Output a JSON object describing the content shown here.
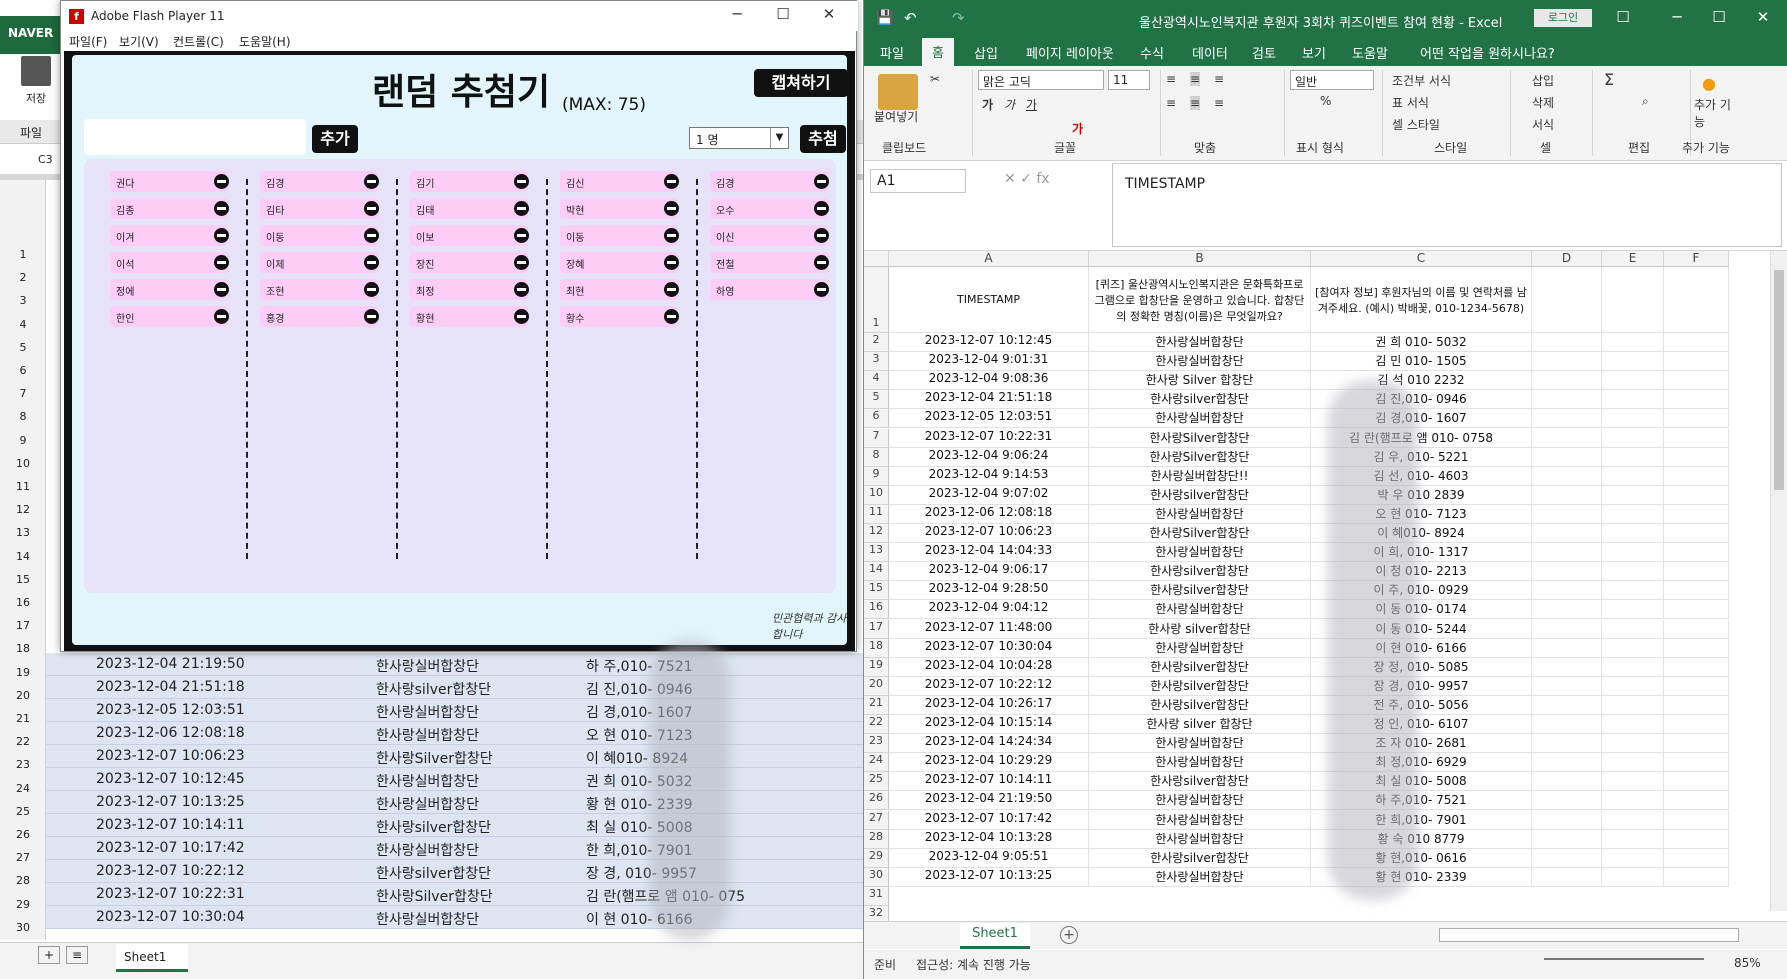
{
  "bg_excel": {
    "brand": "NAVER",
    "save_label": "저장",
    "file_label": "파일",
    "cell_ref": "C3",
    "sheet_tab": "Sheet1",
    "add_tab": "+",
    "menu_tab": "≡",
    "row_numbers": [
      "1",
      "2",
      "3",
      "4",
      "5",
      "6",
      "7",
      "8",
      "9",
      "10",
      "11",
      "12",
      "13",
      "14",
      "15",
      "16",
      "17",
      "18",
      "19",
      "20",
      "21",
      "22",
      "23",
      "24",
      "25",
      "26",
      "27",
      "28",
      "29",
      "30"
    ],
    "rows": [
      {
        "n": "19",
        "ts": "2023-12-04 21:19:50",
        "a": "한사랑실버합창단",
        "c": "하 주,010-    7521"
      },
      {
        "n": "20",
        "ts": "2023-12-04 21:51:18",
        "a": "한사랑silver합창단",
        "c": "김 진,010-   0946"
      },
      {
        "n": "21",
        "ts": "2023-12-05 12:03:51",
        "a": "한사랑실버합창단",
        "c": "김 경,010-   1607"
      },
      {
        "n": "22",
        "ts": "2023-12-06 12:08:18",
        "a": "한사랑실버합창단",
        "c": "오 현 010-   7123"
      },
      {
        "n": "23",
        "ts": "2023-12-07 10:06:23",
        "a": "한사랑Silver합창단",
        "c": "이 혜010-   8924"
      },
      {
        "n": "24",
        "ts": "2023-12-07 10:12:45",
        "a": "한사랑실버합창단",
        "c": "권 희 010-   5032"
      },
      {
        "n": "25",
        "ts": "2023-12-07 10:13:25",
        "a": "한사랑실버합창단",
        "c": "황 현 010-   2339"
      },
      {
        "n": "26",
        "ts": "2023-12-07 10:14:11",
        "a": "한사랑silver합창단",
        "c": "최 실 010-   5008"
      },
      {
        "n": "27",
        "ts": "2023-12-07 10:17:42",
        "a": "한사랑실버합창단",
        "c": "한 희,010-   7901"
      },
      {
        "n": "28",
        "ts": "2023-12-07 10:22:12",
        "a": "한사랑silver합창단",
        "c": "장 경, 010-  9957"
      },
      {
        "n": "29",
        "ts": "2023-12-07 10:22:31",
        "a": "한사랑Silver합창단",
        "c": "김 란(햄프로 앰  010-   075"
      },
      {
        "n": "30",
        "ts": "2023-12-07 10:30:04",
        "a": "한사랑실버합창단",
        "c": "이 현 010-   6166"
      }
    ]
  },
  "flash": {
    "window_title": "Adobe Flash Player 11",
    "logo": "f",
    "menu": [
      "파일(F)",
      "보기(V)",
      "컨트롤(C)",
      "도움말(H)"
    ],
    "controls": [
      "─",
      "☐",
      "✕"
    ],
    "app_title": "랜덤 추첨기",
    "max_label": "(MAX: 75)",
    "capture_button": "캡쳐하기",
    "add_button": "추가",
    "draw_button": "추첨",
    "count_select": "1 명",
    "signature": "민관협력과 감사합니다",
    "columns": [
      [
        "권다",
        "김종",
        "이겨",
        "이석",
        "정에",
        "한인"
      ],
      [
        "김경",
        "김타",
        "이동",
        "이제",
        "조현",
        "홍경"
      ],
      [
        "김기",
        "김태",
        "이보",
        "장진",
        "최정",
        "황현"
      ],
      [
        "김신",
        "박현",
        "이동",
        "장혜",
        "최현",
        "황수"
      ],
      [
        "김경",
        "오수",
        "이신",
        "전철",
        "하영"
      ]
    ]
  },
  "excel": {
    "window_title": "울산광역시노인복지관 후원자 3회차 퀴즈이벤트 참여 현황  -  Excel",
    "login": "로그인",
    "controls": [
      "☐",
      "─",
      "☐",
      "✕"
    ],
    "tabs": [
      "파일",
      "홈",
      "삽입",
      "페이지 레이아웃",
      "수식",
      "데이터",
      "검토",
      "보기",
      "도움말",
      "어떤 작업을 원하시나요?"
    ],
    "ribbon": {
      "paste": "붙여넣기",
      "clipboard": "클립보드",
      "font_name": "맑은 고딕",
      "font_size": "11",
      "font_group": "글꼴",
      "align_group": "맞춤",
      "number_format": "일반",
      "number_group": "표시 형식",
      "cond_format": "조건부 서식",
      "table_format": "표 서식",
      "cell_style": "셀 스타일",
      "style_group": "스타일",
      "insert": "삽입",
      "delete": "삭제",
      "format": "서식",
      "cell_group": "셀",
      "edit_group": "편집",
      "addin": "추가 기능",
      "addin_group": "추가 기능"
    },
    "name_box": "A1",
    "formula": "TIMESTAMP",
    "columns": [
      "A",
      "B",
      "C",
      "D",
      "E",
      "F"
    ],
    "header_row": {
      "a": "TIMESTAMP",
      "b": "[퀴즈] 울산광역시노인복지관은 문화특화프로그램으로 합창단을 운영하고 있습니다. 합창단의 정확한 명칭(이름)은 무엇일까요?",
      "c": "[참여자 정보] 후원자님의 이름 및 연락처를 남겨주세요. (예시) 박배꽃, 010-1234-5678)"
    },
    "rows": [
      {
        "n": "2",
        "a": "2023-12-07 10:12:45",
        "b": "한사랑실버합창단",
        "c": "권 희 010-   5032"
      },
      {
        "n": "3",
        "a": "2023-12-04 9:01:31",
        "b": "한사랑실버합창단",
        "c": "김 민 010-   1505"
      },
      {
        "n": "4",
        "a": "2023-12-04 9:08:36",
        "b": "한사랑 Silver 합창단",
        "c": "김 석 010   2232"
      },
      {
        "n": "5",
        "a": "2023-12-04 21:51:18",
        "b": "한사랑silver합창단",
        "c": "김 진,010-   0946"
      },
      {
        "n": "6",
        "a": "2023-12-05 12:03:51",
        "b": "한사랑실버합창단",
        "c": "김 경,010-   1607"
      },
      {
        "n": "7",
        "a": "2023-12-07 10:22:31",
        "b": "한사랑Silver합창단",
        "c": "김 란(햄프로 앰   010-   0758"
      },
      {
        "n": "8",
        "a": "2023-12-04 9:06:24",
        "b": "한사랑Silver합창단",
        "c": "김 우, 010-  5221"
      },
      {
        "n": "9",
        "a": "2023-12-04 9:14:53",
        "b": "한사랑실버합창단!!",
        "c": "김 선, 010-   4603"
      },
      {
        "n": "10",
        "a": "2023-12-04 9:07:02",
        "b": "한사랑silver합창단",
        "c": "박 우 010   2839"
      },
      {
        "n": "11",
        "a": "2023-12-06 12:08:18",
        "b": "한사랑실버합창단",
        "c": "오 현 010-   7123"
      },
      {
        "n": "12",
        "a": "2023-12-07 10:06:23",
        "b": "한사랑Silver합창단",
        "c": "이 혜010-   8924"
      },
      {
        "n": "13",
        "a": "2023-12-04 14:04:33",
        "b": "한사랑실버합창단",
        "c": "이 희, 010-   1317"
      },
      {
        "n": "14",
        "a": "2023-12-04 9:06:17",
        "b": "한사랑silver합창단",
        "c": "이 청 010-   2213"
      },
      {
        "n": "15",
        "a": "2023-12-04 9:28:50",
        "b": "한사랑silver합창단",
        "c": "이 주, 010-   0929"
      },
      {
        "n": "16",
        "a": "2023-12-04 9:04:12",
        "b": "한사랑실버합창단",
        "c": "이 동 010-   0174"
      },
      {
        "n": "17",
        "a": "2023-12-07 11:48:00",
        "b": "한사랑 silver합창단",
        "c": "이 동 010-   5244"
      },
      {
        "n": "18",
        "a": "2023-12-07 10:30:04",
        "b": "한사랑실버합창단",
        "c": "이 현 010-   6166"
      },
      {
        "n": "19",
        "a": "2023-12-04 10:04:28",
        "b": "한사랑silver합창단",
        "c": "장 정, 010-   5085"
      },
      {
        "n": "20",
        "a": "2023-12-07 10:22:12",
        "b": "한사랑silver합창단",
        "c": "장 경, 010-   9957"
      },
      {
        "n": "21",
        "a": "2023-12-04 10:26:17",
        "b": "한사랑silver합창단",
        "c": "전 주, 010-   5056"
      },
      {
        "n": "22",
        "a": "2023-12-04 10:15:14",
        "b": "한사랑 silver 합창단",
        "c": "정 인, 010-   6107"
      },
      {
        "n": "23",
        "a": "2023-12-04 14:24:34",
        "b": "한사랑실버합창단",
        "c": "조 자 010-   2681"
      },
      {
        "n": "24",
        "a": "2023-12-04 10:29:29",
        "b": "한사랑실버합창단",
        "c": "최 정,010-   6929"
      },
      {
        "n": "25",
        "a": "2023-12-07 10:14:11",
        "b": "한사랑silver합창단",
        "c": "최 실 010-   5008"
      },
      {
        "n": "26",
        "a": "2023-12-04 21:19:50",
        "b": "한사랑실버합창단",
        "c": "하 주,010-   7521"
      },
      {
        "n": "27",
        "a": "2023-12-07 10:17:42",
        "b": "한사랑실버합창단",
        "c": "한 희,010-   7901"
      },
      {
        "n": "28",
        "a": "2023-12-04 10:13:28",
        "b": "한사랑실버합창단",
        "c": "황 숙 010   8779"
      },
      {
        "n": "29",
        "a": "2023-12-04 9:05:51",
        "b": "한사랑silver합창단",
        "c": "황 현,010-   0616"
      },
      {
        "n": "30",
        "a": "2023-12-07 10:13:25",
        "b": "한사랑실버합창단",
        "c": "황 현 010-   2339"
      }
    ],
    "empty_rows": [
      "31",
      "32"
    ],
    "sheet_tab": "Sheet1",
    "status_ready": "준비",
    "status_access": "접근성: 계속 진행 가능",
    "zoom": "85%"
  }
}
